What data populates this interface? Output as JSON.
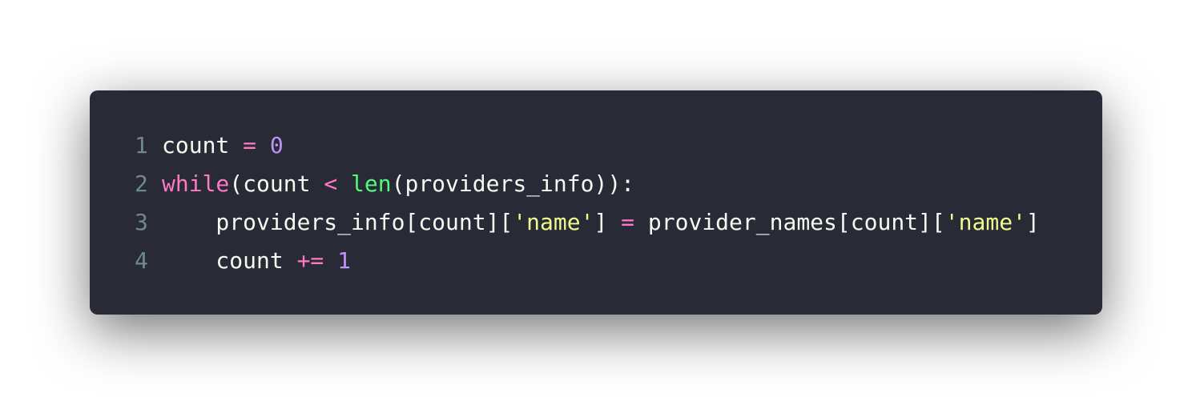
{
  "code_block": {
    "language": "python",
    "theme_colors": {
      "background": "#282a36",
      "plain": "#f8f8f2",
      "keyword": "#ff79c6",
      "operator": "#ff79c6",
      "number": "#bd93f9",
      "builtin": "#50fa7b",
      "string": "#f1fa8c",
      "line_number": "#6d8a88"
    },
    "lines": [
      {
        "number": "1",
        "tokens": [
          {
            "type": "plain",
            "text": "count "
          },
          {
            "type": "operator",
            "text": "="
          },
          {
            "type": "plain",
            "text": " "
          },
          {
            "type": "number",
            "text": "0"
          }
        ]
      },
      {
        "number": "2",
        "tokens": [
          {
            "type": "keyword",
            "text": "while"
          },
          {
            "type": "plain",
            "text": "(count "
          },
          {
            "type": "operator",
            "text": "<"
          },
          {
            "type": "plain",
            "text": " "
          },
          {
            "type": "builtin",
            "text": "len"
          },
          {
            "type": "plain",
            "text": "(providers_info)):"
          }
        ]
      },
      {
        "number": "3",
        "tokens": [
          {
            "type": "plain",
            "text": "    providers_info[count]["
          },
          {
            "type": "string",
            "text": "'name'"
          },
          {
            "type": "plain",
            "text": "] "
          },
          {
            "type": "operator",
            "text": "="
          },
          {
            "type": "plain",
            "text": " provider_names[count]["
          },
          {
            "type": "string",
            "text": "'name'"
          },
          {
            "type": "plain",
            "text": "]"
          }
        ]
      },
      {
        "number": "4",
        "tokens": [
          {
            "type": "plain",
            "text": "    count "
          },
          {
            "type": "operator",
            "text": "+="
          },
          {
            "type": "plain",
            "text": " "
          },
          {
            "type": "number",
            "text": "1"
          }
        ]
      }
    ]
  }
}
